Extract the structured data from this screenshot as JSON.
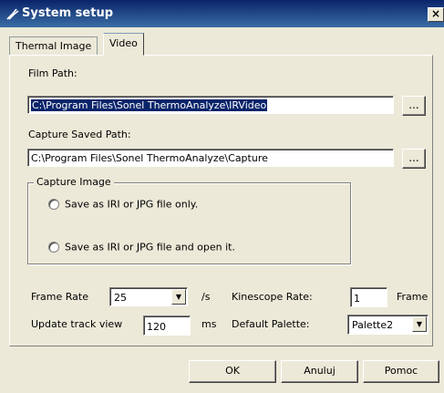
{
  "window": {
    "title": "System setup",
    "close_label": "×"
  },
  "tabs": [
    {
      "label": "Thermal Image",
      "active": false
    },
    {
      "label": "Video",
      "active": true
    }
  ],
  "film_path": {
    "label": "Film Path:",
    "value": "C:\\Program Files\\Sonel ThermoAnalyze\\IRVideo",
    "browse_label": "..."
  },
  "capture_path": {
    "label": "Capture Saved Path:",
    "value": "C:\\Program Files\\Sonel ThermoAnalyze\\Capture",
    "browse_label": "..."
  },
  "capture_image": {
    "label": "Capture Image",
    "options": [
      {
        "label": "Save as IRI or JPG file only.",
        "selected": false
      },
      {
        "label": "Save as IRI or JPG file and open it.",
        "selected": false
      }
    ]
  },
  "frame_rate": {
    "label": "Frame Rate",
    "value": "25",
    "unit": "/s"
  },
  "kinescope_rate": {
    "label": "Kinescope Rate:",
    "value": "1",
    "unit": "Frame"
  },
  "update_track": {
    "label": "Update track view",
    "value": "120",
    "unit": "ms"
  },
  "default_palette": {
    "label": "Default Palette:",
    "value": "Palette2"
  },
  "buttons": {
    "ok": "OK",
    "cancel": "Anuluj",
    "help": "Pomoc"
  },
  "colors": {
    "titlebar": "#0a246a",
    "dialog_bg": "#ECE9D8",
    "selection": "#0a246a"
  }
}
